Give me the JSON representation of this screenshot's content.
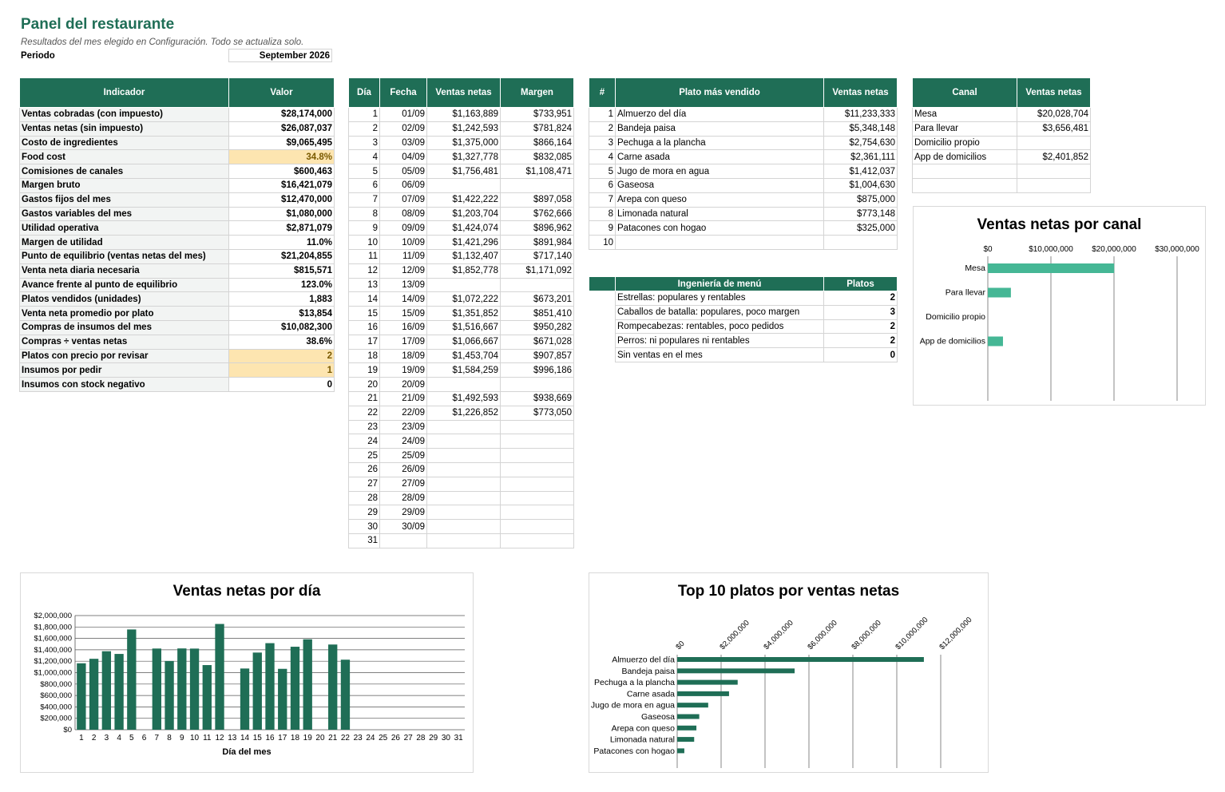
{
  "header": {
    "title": "Panel del restaurante",
    "subtitle": "Resultados del mes elegido en Configuración. Todo se actualiza solo.",
    "period_label": "Periodo",
    "period_value": "September 2026"
  },
  "kpi": {
    "col_indicator": "Indicador",
    "col_value": "Valor",
    "rows": [
      {
        "label": "Ventas cobradas (con impuesto)",
        "value": "$28,174,000"
      },
      {
        "label": "Ventas netas (sin impuesto)",
        "value": "$26,087,037"
      },
      {
        "label": "Costo de ingredientes",
        "value": "$9,065,495"
      },
      {
        "label": "Food cost",
        "value": "34.8%",
        "highlight": true
      },
      {
        "label": "Comisiones de canales",
        "value": "$600,463"
      },
      {
        "label": "Margen bruto",
        "value": "$16,421,079"
      },
      {
        "label": "Gastos fijos del mes",
        "value": "$12,470,000"
      },
      {
        "label": "Gastos variables del mes",
        "value": "$1,080,000"
      },
      {
        "label": "Utilidad operativa",
        "value": "$2,871,079"
      },
      {
        "label": "Margen de utilidad",
        "value": "11.0%"
      },
      {
        "label": "Punto de equilibrio (ventas netas del mes)",
        "value": "$21,204,855"
      },
      {
        "label": "Venta neta diaria necesaria",
        "value": "$815,571"
      },
      {
        "label": "Avance frente al punto de equilibrio",
        "value": "123.0%"
      },
      {
        "label": "Platos vendidos (unidades)",
        "value": "1,883"
      },
      {
        "label": "Venta neta promedio por plato",
        "value": "$13,854"
      },
      {
        "label": "Compras de insumos del mes",
        "value": "$10,082,300"
      },
      {
        "label": "Compras ÷ ventas netas",
        "value": "38.6%"
      },
      {
        "label": "Platos con precio por revisar",
        "value": "2",
        "highlight": true
      },
      {
        "label": "Insumos por pedir",
        "value": "1",
        "highlight": true
      },
      {
        "label": "Insumos con stock negativo",
        "value": "0"
      }
    ]
  },
  "daily": {
    "col_day": "Día",
    "col_date": "Fecha",
    "col_sales": "Ventas netas",
    "col_margin": "Margen",
    "rows": [
      {
        "day": "1",
        "date": "01/09",
        "sales": "$1,163,889",
        "margin": "$733,951"
      },
      {
        "day": "2",
        "date": "02/09",
        "sales": "$1,242,593",
        "margin": "$781,824"
      },
      {
        "day": "3",
        "date": "03/09",
        "sales": "$1,375,000",
        "margin": "$866,164"
      },
      {
        "day": "4",
        "date": "04/09",
        "sales": "$1,327,778",
        "margin": "$832,085"
      },
      {
        "day": "5",
        "date": "05/09",
        "sales": "$1,756,481",
        "margin": "$1,108,471"
      },
      {
        "day": "6",
        "date": "06/09",
        "sales": "",
        "margin": ""
      },
      {
        "day": "7",
        "date": "07/09",
        "sales": "$1,422,222",
        "margin": "$897,058"
      },
      {
        "day": "8",
        "date": "08/09",
        "sales": "$1,203,704",
        "margin": "$762,666"
      },
      {
        "day": "9",
        "date": "09/09",
        "sales": "$1,424,074",
        "margin": "$896,962"
      },
      {
        "day": "10",
        "date": "10/09",
        "sales": "$1,421,296",
        "margin": "$891,984"
      },
      {
        "day": "11",
        "date": "11/09",
        "sales": "$1,132,407",
        "margin": "$717,140"
      },
      {
        "day": "12",
        "date": "12/09",
        "sales": "$1,852,778",
        "margin": "$1,171,092"
      },
      {
        "day": "13",
        "date": "13/09",
        "sales": "",
        "margin": ""
      },
      {
        "day": "14",
        "date": "14/09",
        "sales": "$1,072,222",
        "margin": "$673,201"
      },
      {
        "day": "15",
        "date": "15/09",
        "sales": "$1,351,852",
        "margin": "$851,410"
      },
      {
        "day": "16",
        "date": "16/09",
        "sales": "$1,516,667",
        "margin": "$950,282"
      },
      {
        "day": "17",
        "date": "17/09",
        "sales": "$1,066,667",
        "margin": "$671,028"
      },
      {
        "day": "18",
        "date": "18/09",
        "sales": "$1,453,704",
        "margin": "$907,857"
      },
      {
        "day": "19",
        "date": "19/09",
        "sales": "$1,584,259",
        "margin": "$996,186"
      },
      {
        "day": "20",
        "date": "20/09",
        "sales": "",
        "margin": ""
      },
      {
        "day": "21",
        "date": "21/09",
        "sales": "$1,492,593",
        "margin": "$938,669"
      },
      {
        "day": "22",
        "date": "22/09",
        "sales": "$1,226,852",
        "margin": "$773,050"
      },
      {
        "day": "23",
        "date": "23/09",
        "sales": "",
        "margin": ""
      },
      {
        "day": "24",
        "date": "24/09",
        "sales": "",
        "margin": ""
      },
      {
        "day": "25",
        "date": "25/09",
        "sales": "",
        "margin": ""
      },
      {
        "day": "26",
        "date": "26/09",
        "sales": "",
        "margin": ""
      },
      {
        "day": "27",
        "date": "27/09",
        "sales": "",
        "margin": ""
      },
      {
        "day": "28",
        "date": "28/09",
        "sales": "",
        "margin": ""
      },
      {
        "day": "29",
        "date": "29/09",
        "sales": "",
        "margin": ""
      },
      {
        "day": "30",
        "date": "30/09",
        "sales": "",
        "margin": ""
      },
      {
        "day": "31",
        "date": "",
        "sales": "",
        "margin": ""
      }
    ]
  },
  "top_dishes": {
    "col_num": "#",
    "col_dish": "Plato más vendido",
    "col_sales": "Ventas netas",
    "rows": [
      {
        "n": "1",
        "dish": "Almuerzo del día",
        "sales": "$11,233,333"
      },
      {
        "n": "2",
        "dish": "Bandeja paisa",
        "sales": "$5,348,148"
      },
      {
        "n": "3",
        "dish": "Pechuga a la plancha",
        "sales": "$2,754,630"
      },
      {
        "n": "4",
        "dish": "Carne asada",
        "sales": "$2,361,111"
      },
      {
        "n": "5",
        "dish": "Jugo de mora en agua",
        "sales": "$1,412,037"
      },
      {
        "n": "6",
        "dish": "Gaseosa",
        "sales": "$1,004,630"
      },
      {
        "n": "7",
        "dish": "Arepa con queso",
        "sales": "$875,000"
      },
      {
        "n": "8",
        "dish": "Limonada natural",
        "sales": "$773,148"
      },
      {
        "n": "9",
        "dish": "Patacones con hogao",
        "sales": "$325,000"
      },
      {
        "n": "10",
        "dish": "",
        "sales": ""
      }
    ]
  },
  "menu_engineering": {
    "col_name": "Ingeniería de menú",
    "col_count": "Platos",
    "rows": [
      {
        "label": "Estrellas: populares y rentables",
        "count": "2"
      },
      {
        "label": "Caballos de batalla: populares, poco margen",
        "count": "3"
      },
      {
        "label": "Rompecabezas: rentables, poco pedidos",
        "count": "2"
      },
      {
        "label": "Perros: ni populares ni rentables",
        "count": "2"
      },
      {
        "label": "Sin ventas en el mes",
        "count": "0"
      }
    ]
  },
  "channels": {
    "col_channel": "Canal",
    "col_sales": "Ventas netas",
    "rows": [
      {
        "channel": "Mesa",
        "sales": "$20,028,704"
      },
      {
        "channel": "Para llevar",
        "sales": "$3,656,481"
      },
      {
        "channel": "Domicilio propio",
        "sales": ""
      },
      {
        "channel": "App de domicilios",
        "sales": "$2,401,852"
      },
      {
        "channel": "",
        "sales": ""
      },
      {
        "channel": "",
        "sales": ""
      }
    ]
  },
  "colors": {
    "header_green": "#1f6e56",
    "bar_dark": "#1f6e56",
    "bar_light": "#45b795",
    "highlight": "#fde5b0"
  },
  "chart_data": [
    {
      "id": "channel",
      "type": "bar",
      "orientation": "horizontal",
      "title": "Ventas netas por canal",
      "categories": [
        "Mesa",
        "Para llevar",
        "Domicilio propio",
        "App de domicilios"
      ],
      "values": [
        20028704,
        3656481,
        0,
        2401852
      ],
      "xlim": [
        0,
        30000000
      ],
      "ticks": [
        0,
        10000000,
        20000000,
        30000000
      ],
      "tick_labels": [
        "$0",
        "$10,000,000",
        "$20,000,000",
        "$30,000,000"
      ],
      "grid": true
    },
    {
      "id": "daily",
      "type": "bar",
      "title": "Ventas netas por día",
      "xlabel": "Día del mes",
      "categories": [
        "1",
        "2",
        "3",
        "4",
        "5",
        "6",
        "7",
        "8",
        "9",
        "10",
        "11",
        "12",
        "13",
        "14",
        "15",
        "16",
        "17",
        "18",
        "19",
        "20",
        "21",
        "22",
        "23",
        "24",
        "25",
        "26",
        "27",
        "28",
        "29",
        "30",
        "31"
      ],
      "values": [
        1163889,
        1242593,
        1375000,
        1327778,
        1756481,
        0,
        1422222,
        1203704,
        1424074,
        1421296,
        1132407,
        1852778,
        0,
        1072222,
        1351852,
        1516667,
        1066667,
        1453704,
        1584259,
        0,
        1492593,
        1226852,
        0,
        0,
        0,
        0,
        0,
        0,
        0,
        0,
        0
      ],
      "ylim": [
        0,
        2000000
      ],
      "ticks": [
        0,
        200000,
        400000,
        600000,
        800000,
        1000000,
        1200000,
        1400000,
        1600000,
        1800000,
        2000000
      ],
      "tick_labels": [
        "$0",
        "$200,000",
        "$400,000",
        "$600,000",
        "$800,000",
        "$1,000,000",
        "$1,200,000",
        "$1,400,000",
        "$1,600,000",
        "$1,800,000",
        "$2,000,000"
      ],
      "grid": true
    },
    {
      "id": "top10",
      "type": "bar",
      "orientation": "horizontal",
      "title": "Top 10 platos por ventas netas",
      "categories": [
        "Almuerzo del día",
        "Bandeja paisa",
        "Pechuga a la plancha",
        "Carne asada",
        "Jugo de mora en agua",
        "Gaseosa",
        "Arepa con queso",
        "Limonada natural",
        "Patacones con hogao"
      ],
      "values": [
        11233333,
        5348148,
        2754630,
        2361111,
        1412037,
        1004630,
        875000,
        773148,
        325000
      ],
      "xlim": [
        0,
        12000000
      ],
      "ticks": [
        0,
        2000000,
        4000000,
        6000000,
        8000000,
        10000000,
        12000000
      ],
      "tick_labels": [
        "$0",
        "$2,000,000",
        "$4,000,000",
        "$6,000,000",
        "$8,000,000",
        "$10,000,000",
        "$12,000,000"
      ],
      "grid": true
    }
  ]
}
